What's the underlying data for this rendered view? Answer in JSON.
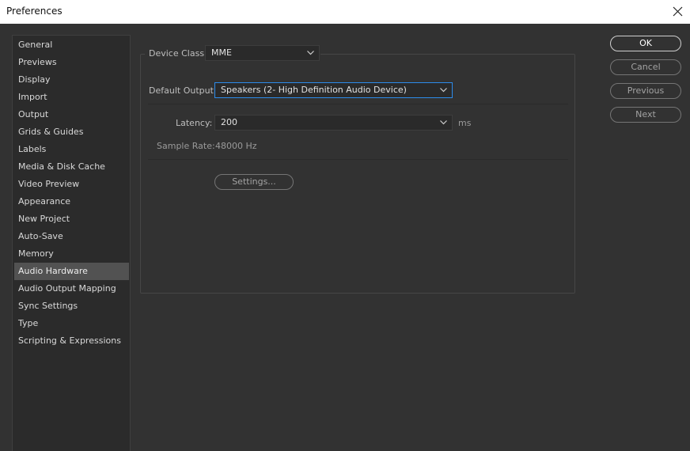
{
  "window": {
    "title": "Preferences",
    "close_icon": "close-icon"
  },
  "sidebar": {
    "items": [
      {
        "label": "General"
      },
      {
        "label": "Previews"
      },
      {
        "label": "Display"
      },
      {
        "label": "Import"
      },
      {
        "label": "Output"
      },
      {
        "label": "Grids & Guides"
      },
      {
        "label": "Labels"
      },
      {
        "label": "Media & Disk Cache"
      },
      {
        "label": "Video Preview"
      },
      {
        "label": "Appearance"
      },
      {
        "label": "New Project"
      },
      {
        "label": "Auto-Save"
      },
      {
        "label": "Memory"
      },
      {
        "label": "Audio Hardware",
        "selected": true
      },
      {
        "label": "Audio Output Mapping"
      },
      {
        "label": "Sync Settings"
      },
      {
        "label": "Type"
      },
      {
        "label": "Scripting & Expressions"
      }
    ]
  },
  "audio_hardware": {
    "device_class": {
      "label": "Device Class:",
      "value": "MME"
    },
    "default_output": {
      "label": "Default Output:",
      "value": "Speakers (2- High Definition Audio Device)"
    },
    "latency": {
      "label": "Latency:",
      "value": "200",
      "unit": "ms"
    },
    "sample_rate": {
      "label": "Sample Rate:",
      "value": "48000 Hz"
    },
    "settings_button": "Settings..."
  },
  "actions": {
    "ok": "OK",
    "cancel": "Cancel",
    "previous": "Previous",
    "next": "Next"
  },
  "colors": {
    "background": "#323232",
    "sidebar_bg": "#2b2b2b",
    "selected_item": "#525252",
    "focus_border": "#2d8ceb",
    "titlebar": "#ffffff"
  }
}
